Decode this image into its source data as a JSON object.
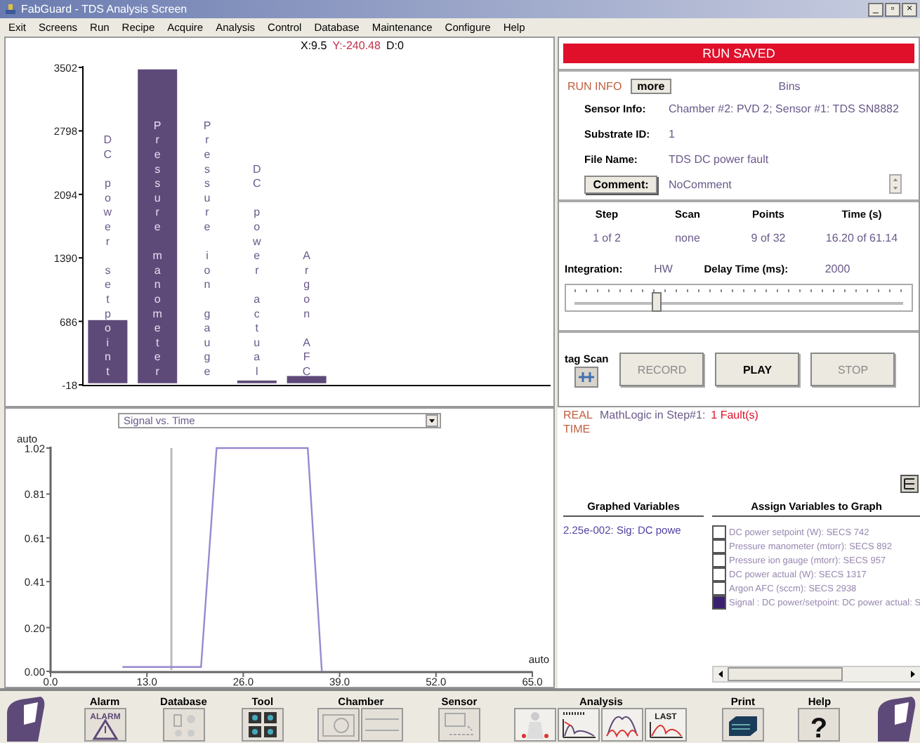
{
  "window": {
    "title": "FabGuard - TDS Analysis Screen",
    "controls": [
      "_",
      "▫",
      "×"
    ]
  },
  "menu": [
    "Exit",
    "Screens",
    "Run",
    "Recipe",
    "Acquire",
    "Analysis",
    "Control",
    "Database",
    "Maintenance",
    "Configure",
    "Help"
  ],
  "bar_panel": {
    "readout": {
      "x": "X:9.5",
      "y": "Y:-240.48",
      "d": "D:0"
    },
    "chart_data": {
      "type": "bar",
      "categories": [
        "DC power setpoint",
        "Pressure manometer",
        "Pressure ion gauge",
        "DC power actual",
        "Argon AFC"
      ],
      "series": [
        {
          "color": "#5e4a78",
          "values": [
            700,
            3480,
            0,
            30,
            80
          ]
        }
      ],
      "ylim": [
        -18,
        3502
      ],
      "yticks": [
        -18,
        686,
        1390,
        2094,
        2798,
        3502
      ]
    }
  },
  "run_panel": {
    "status": "RUN SAVED",
    "run_info_label": "RUN INFO",
    "more_button": "more",
    "bins_label": "Bins",
    "fields": [
      {
        "label": "Sensor Info:",
        "value": "Chamber #2: PVD 2; Sensor #1: TDS SN8882",
        "kind": "text"
      },
      {
        "label": "Substrate ID:",
        "value": "1",
        "kind": "text"
      },
      {
        "label": "File Name:",
        "value": "TDS DC power fault",
        "kind": "text"
      },
      {
        "label": "Comment:",
        "value": "NoComment",
        "kind": "button"
      }
    ],
    "step_table": {
      "columns": [
        "Step",
        "Scan",
        "Points",
        "Time (s)"
      ],
      "values": [
        "1 of 2",
        "none",
        "9 of 32",
        "16.20 of 61.14"
      ]
    },
    "integration_label": "Integration:",
    "integration_value": "HW",
    "delay_label": "Delay Time (ms):",
    "delay_value": "2000",
    "slider": {
      "level": 0.26
    },
    "tag_scan_label": "tag Scan",
    "buttons": [
      {
        "label": "RECORD",
        "disabled": true
      },
      {
        "label": "PLAY",
        "disabled": false
      },
      {
        "label": "STOP",
        "disabled": true
      }
    ]
  },
  "line_panel": {
    "dropdown": "Signal vs. Time",
    "chart_data": {
      "type": "line",
      "xlabel": "auto",
      "ylabel": "auto",
      "x": [
        9.7,
        20.3,
        22.4,
        34.7,
        36.6
      ],
      "series": [
        {
          "color": "#9a88d0",
          "values": [
            0.02,
            0.02,
            1.02,
            1.02,
            0
          ]
        }
      ],
      "xlim": [
        0,
        65
      ],
      "ylim": [
        0,
        1.02
      ],
      "xticks": [
        {
          "value": 0,
          "label": "0.0"
        },
        {
          "value": 13,
          "label": "13.0"
        },
        {
          "value": 26,
          "label": "26.0"
        },
        {
          "value": 39,
          "label": "39.0"
        },
        {
          "value": 52,
          "label": "52.0"
        },
        {
          "value": 65,
          "label": "65.0"
        }
      ],
      "yticks": [
        {
          "value": 0,
          "label": "0.00"
        },
        {
          "value": 0.2,
          "label": "0.20"
        },
        {
          "value": 0.41,
          "label": "0.41"
        },
        {
          "value": 0.61,
          "label": "0.61"
        },
        {
          "value": 0.81,
          "label": "0.81"
        },
        {
          "value": 1.02,
          "label": "1.02"
        }
      ],
      "ref_lines": [
        {
          "axis": "x",
          "value": 16.3
        }
      ]
    }
  },
  "variables_panel": {
    "mode": "REAL TIME",
    "message": "MathLogic in Step#1:",
    "fault": "1 Fault(s)",
    "graphed_header": "Graphed Variables",
    "graphed": [
      "2.25e-002: Sig: DC powe"
    ],
    "assign_header": "Assign Variables to Graph",
    "assign": [
      {
        "label": "DC power setpoint (W): SECS 742",
        "checked": false
      },
      {
        "label": "Pressure manometer (mtorr): SECS 892",
        "checked": false
      },
      {
        "label": "Pressure ion gauge (mtorr): SECS 957",
        "checked": false
      },
      {
        "label": "DC power actual (W): SECS 1317",
        "checked": false
      },
      {
        "label": "Argon AFC (sccm): SECS 2938",
        "checked": false
      },
      {
        "label": "Signal : DC power/setpoint: DC power actual: S",
        "checked": true
      }
    ]
  },
  "toolbar": [
    {
      "label": "Alarm",
      "icons": [
        {
          "kind": "alarm",
          "text": "ALARM"
        }
      ]
    },
    {
      "label": "Database",
      "icons": [
        {
          "kind": "database"
        }
      ]
    },
    {
      "label": "Tool",
      "icons": [
        {
          "kind": "tool"
        }
      ]
    },
    {
      "label": "Chamber",
      "icons": [
        {
          "kind": "chamber"
        },
        {
          "kind": "panel"
        }
      ]
    },
    {
      "label": "Sensor",
      "icons": [
        {
          "kind": "sensor"
        }
      ]
    },
    {
      "label": "Analysis",
      "icons": [
        {
          "kind": "person"
        },
        {
          "kind": "spectrum"
        },
        {
          "kind": "peaks"
        },
        {
          "kind": "last",
          "text": "LAST"
        }
      ]
    },
    {
      "label": "Print",
      "icons": [
        {
          "kind": "printer"
        }
      ]
    },
    {
      "label": "Help",
      "icons": [
        {
          "kind": "help",
          "text": "?"
        }
      ]
    }
  ]
}
